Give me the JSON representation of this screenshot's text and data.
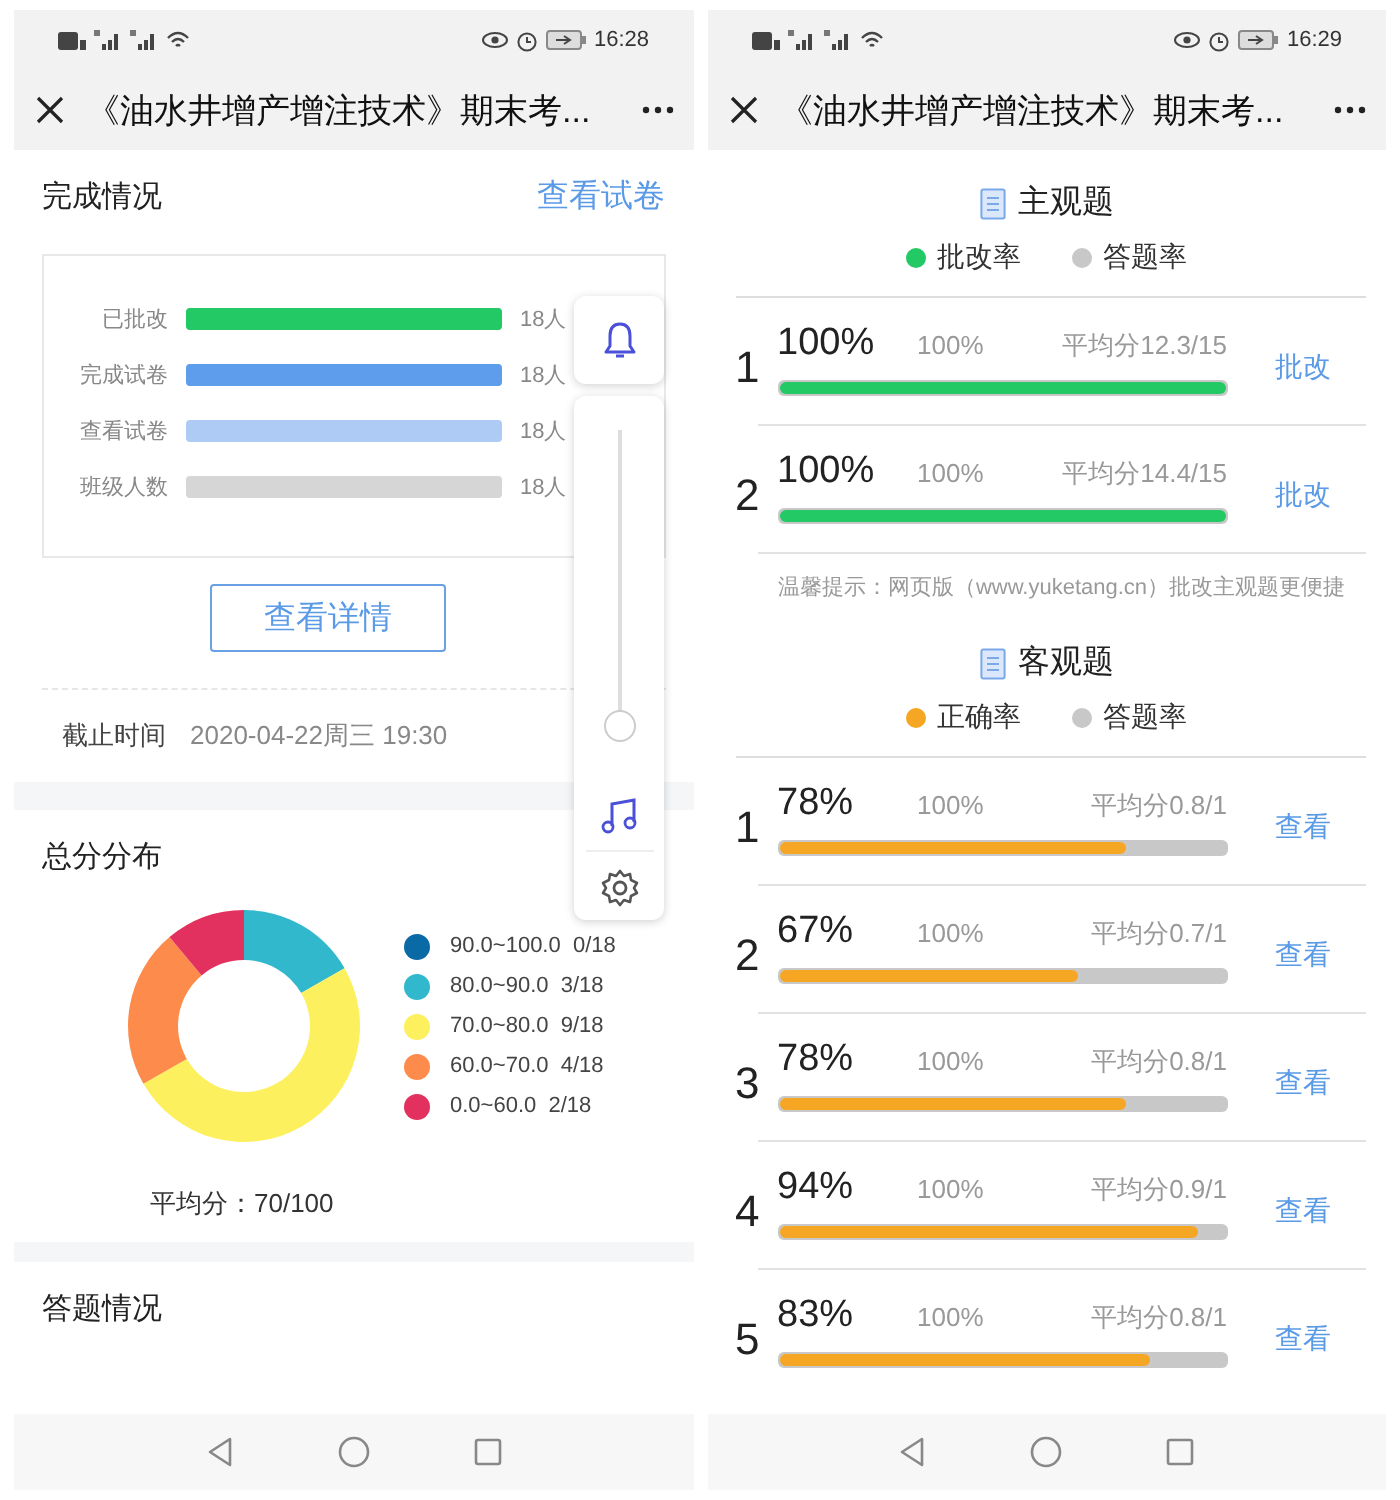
{
  "left_screen": {
    "status_bar": {
      "time": "16:28"
    },
    "title": "《油水井增产增注技术》期末考...",
    "completion": {
      "title": "完成情况",
      "link": "查看试卷",
      "bars": [
        {
          "label": "已批改",
          "level": 1,
          "color": "#22c965",
          "count": "18人"
        },
        {
          "label": "完成试卷",
          "level": 1,
          "color": "#5e9cec",
          "count": "18人"
        },
        {
          "label": "查看试卷",
          "level": 1,
          "color": "#aecbf5",
          "count": "18人"
        },
        {
          "label": "班级人数",
          "level": 1,
          "color": "#d6d6d6",
          "count": "18人"
        }
      ],
      "details_button": "查看详情",
      "deadline": {
        "label": "截止时间",
        "value": "2020-04-22周三 19:30"
      }
    },
    "distribution": {
      "title": "总分分布",
      "chart_data": {
        "type": "donut",
        "categories": [
          "90.0~100.0",
          "80.0~90.0",
          "70.0~80.0",
          "60.0~70.0",
          "0.0~60.0"
        ],
        "series": [
          {
            "values": [
              0,
              16.7,
              50,
              22.2,
              11.1
            ]
          }
        ]
      },
      "legend": [
        {
          "count": "0/18",
          "color": "#0a6aa6"
        },
        {
          "count": "3/18",
          "color": "#31b8cc"
        },
        {
          "count": "9/18",
          "color": "#fdf05e"
        },
        {
          "count": "4/18",
          "color": "#fd8c4c"
        },
        {
          "count": "2/18",
          "color": "#e2305f"
        }
      ],
      "average": "平均分：70/100"
    },
    "answers": {
      "title": "答题情况"
    },
    "float_panel": {
      "slider": {
        "level": 0
      }
    }
  },
  "right_screen": {
    "status_bar": {
      "time": "16:29"
    },
    "title": "《油水井增产增注技术》期末考...",
    "subjective": {
      "title": "主观题",
      "legend": [
        {
          "label": "批改率",
          "color": "#22c965"
        },
        {
          "label": "答题率",
          "color": "#c8c8c8"
        }
      ],
      "rows": [
        {
          "number": "1",
          "rate": "100%",
          "answer_rate": "100%",
          "average": "平均分12.3/15",
          "level": 1,
          "action": "批改"
        },
        {
          "number": "2",
          "rate": "100%",
          "answer_rate": "100%",
          "average": "平均分14.4/15",
          "level": 1,
          "action": "批改"
        }
      ],
      "tip": "温馨提示：网页版（www.yuketang.cn）批改主观题更便捷"
    },
    "objective": {
      "title": "客观题",
      "legend": [
        {
          "label": "正确率",
          "color": "#f5a623"
        },
        {
          "label": "答题率",
          "color": "#c8c8c8"
        }
      ],
      "rows": [
        {
          "number": "1",
          "rate": "78%",
          "answer_rate": "100%",
          "average": "平均分0.8/1",
          "level": 0.78,
          "action": "查看"
        },
        {
          "number": "2",
          "rate": "67%",
          "answer_rate": "100%",
          "average": "平均分0.7/1",
          "level": 0.67,
          "action": "查看"
        },
        {
          "number": "3",
          "rate": "78%",
          "answer_rate": "100%",
          "average": "平均分0.8/1",
          "level": 0.78,
          "action": "查看"
        },
        {
          "number": "4",
          "rate": "94%",
          "answer_rate": "100%",
          "average": "平均分0.9/1",
          "level": 0.94,
          "action": "查看"
        },
        {
          "number": "5",
          "rate": "83%",
          "answer_rate": "100%",
          "average": "平均分0.8/1",
          "level": 0.83,
          "action": "查看"
        }
      ]
    }
  }
}
